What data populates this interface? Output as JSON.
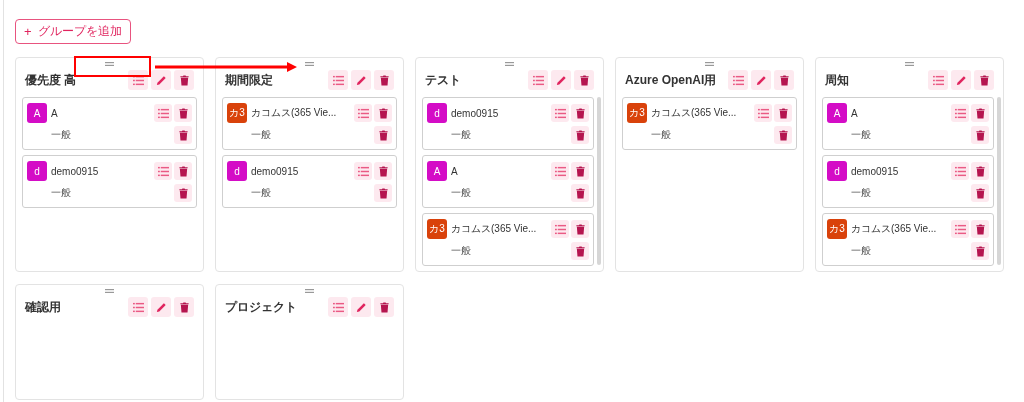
{
  "add_group_button": {
    "icon": "+",
    "label": "グループを追加"
  },
  "groups": [
    {
      "title": "優先度 高",
      "members": [
        {
          "initials": "A",
          "color": "#d40cc6",
          "name": "A",
          "role": "一般"
        },
        {
          "initials": "d",
          "color": "#d40cc6",
          "name": "demo0915",
          "role": "一般"
        }
      ]
    },
    {
      "title": "期間限定",
      "members": [
        {
          "initials": "カ3",
          "color": "#d9420b",
          "name": "カコムス(365 Vie...",
          "role": "一般"
        },
        {
          "initials": "d",
          "color": "#d40cc6",
          "name": "demo0915",
          "role": "一般"
        }
      ]
    },
    {
      "title": "テスト",
      "scrollable": true,
      "members": [
        {
          "initials": "d",
          "color": "#d40cc6",
          "name": "demo0915",
          "role": "一般"
        },
        {
          "initials": "A",
          "color": "#d40cc6",
          "name": "A",
          "role": "一般"
        },
        {
          "initials": "カ3",
          "color": "#d9420b",
          "name": "カコムス(365 Vie...",
          "role": "一般"
        }
      ]
    },
    {
      "title": "Azure OpenAI用",
      "members": [
        {
          "initials": "カ3",
          "color": "#d9420b",
          "name": "カコムス(365 Vie...",
          "role": "一般"
        }
      ]
    },
    {
      "title": "周知",
      "scrollable": true,
      "members": [
        {
          "initials": "A",
          "color": "#d40cc6",
          "name": "A",
          "role": "一般"
        },
        {
          "initials": "d",
          "color": "#d40cc6",
          "name": "demo0915",
          "role": "一般"
        },
        {
          "initials": "カ3",
          "color": "#d9420b",
          "name": "カコムス(365 Vie...",
          "role": "一般"
        }
      ]
    },
    {
      "title": "確認用"
    },
    {
      "title": "プロジェクト"
    }
  ]
}
